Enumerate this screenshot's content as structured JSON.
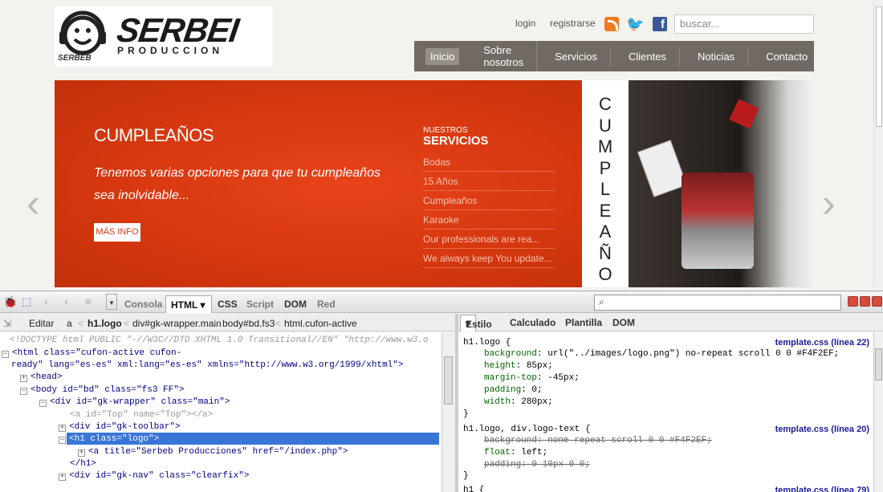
{
  "site": {
    "logo": {
      "brand": "SERBEI",
      "tagline": "PRODUCCION",
      "mini": "SERBEB"
    },
    "top_links": {
      "login": "login",
      "register": "registrarse"
    },
    "search_placeholder": "buscar...",
    "nav": [
      "Inicio",
      "Sobre nosotros",
      "Servicios",
      "Clientes",
      "Noticias",
      "Contacto"
    ],
    "slide": {
      "title": "CUMPLEAÑOS",
      "description": "Tenemos varias opciones para que tu cumpleaños sea inolvidable...",
      "more": "MÁS INFO",
      "vertical_word": "CUMPLEAÑO"
    },
    "services": {
      "label_small": "NUESTROS",
      "label_big": "SERVICIOS",
      "items": [
        "Bodas",
        "15 Años",
        "Cumpleaños",
        "Karaoke",
        "Our professionals are rea...",
        "We always keep You update..."
      ]
    }
  },
  "firebug": {
    "tabs": [
      "Consola",
      "HTML",
      "CSS",
      "Script",
      "DOM",
      "Red"
    ],
    "crumbs": [
      "Editar",
      "a",
      "h1.logo",
      "div#gk-wrapper.main",
      "body#bd.fs3",
      "html.cufon-active"
    ],
    "panel_tabs": [
      "Estilo",
      "Calculado",
      "Plantilla",
      "DOM"
    ],
    "tree": [
      "<!DOCTYPE html PUBLIC \"-//W3C//DTD XHTML 1.0 Transitional//EN\" \"http://www.w3.o",
      "<html class=\"cufon-active cufon-",
      "ready\" lang=\"es-es\" xml:lang=\"es-es\" xmlns=\"http://www.w3.org/1999/xhtml\">",
      "<head>",
      "<body id=\"bd\" class=\"fs3 FF\">",
      "<div id=\"gk-wrapper\" class=\"main\">",
      "<a id=\"Top\" name=\"Top\"></a>",
      "<div id=\"gk-toolbar\">",
      "<h1 class=\"logo\">",
      "<a title=\"Serbeb Producciones\" href=\"/index.php\">",
      "</h1>",
      "<div id=\"gk-nav\" class=\"clearfix\">"
    ],
    "styles": {
      "rule1": {
        "selector": "h1.logo {",
        "source": "template.css (línea 22)",
        "props": [
          [
            "background",
            "url(\"../images/logo.png\") no-repeat scroll 0 0 #F4F2EF;"
          ],
          [
            "height",
            "85px;"
          ],
          [
            "margin-top",
            "-45px;"
          ],
          [
            "padding",
            "0;"
          ],
          [
            "width",
            "280px;"
          ]
        ]
      },
      "rule2": {
        "selector": "h1.logo, div.logo-text {",
        "source": "template.css (línea 20)",
        "props": [
          [
            "background",
            "none repeat scroll 0 0 #F4F2EF;"
          ],
          [
            "float",
            "left;"
          ],
          [
            "padding",
            "0 10px 0 0;"
          ]
        ]
      },
      "rule3": {
        "selector": "h1 {",
        "source": "template.css (línea 79)"
      },
      "close": "}"
    }
  }
}
